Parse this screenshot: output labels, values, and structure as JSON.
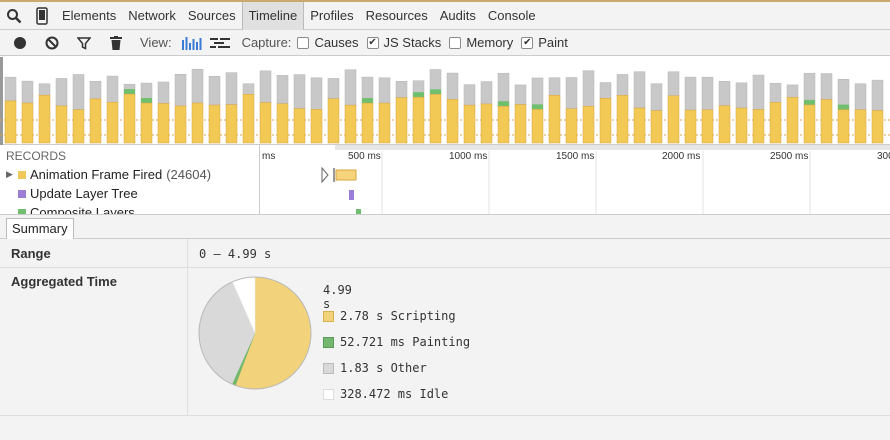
{
  "tabs": [
    {
      "label": "Elements"
    },
    {
      "label": "Network"
    },
    {
      "label": "Sources"
    },
    {
      "label": "Timeline",
      "active": true
    },
    {
      "label": "Profiles"
    },
    {
      "label": "Resources"
    },
    {
      "label": "Audits"
    },
    {
      "label": "Console"
    }
  ],
  "toolbar": {
    "view_label": "View:",
    "capture_label": "Capture:",
    "checkboxes": [
      {
        "label": "Causes",
        "checked": false
      },
      {
        "label": "JS Stacks",
        "checked": true
      },
      {
        "label": "Memory",
        "checked": false
      },
      {
        "label": "Paint",
        "checked": true
      }
    ]
  },
  "records": {
    "header": "RECORDS",
    "items": [
      {
        "label": "Animation Frame Fired",
        "count": "(24604)",
        "color": "#f0c95c",
        "expandable": true
      },
      {
        "label": "Update Layer Tree",
        "count": "",
        "color": "#9b7fd6",
        "expandable": false
      },
      {
        "label": "Composite Layers",
        "count": "",
        "color": "#6fbf6f",
        "expandable": false
      }
    ]
  },
  "ruler": {
    "ticks": [
      "ms",
      "500 ms",
      "1000 ms",
      "1500 ms",
      "2000 ms",
      "2500 ms",
      "300"
    ]
  },
  "summary": {
    "tab_label": "Summary",
    "range_label": "Range",
    "range_value": "0 – 4.99 s",
    "aggregated_label": "Aggregated Time",
    "total": "4.99 s",
    "legend": [
      {
        "label": "2.78 s Scripting",
        "color": "#f2d27a",
        "value_s": 2.78
      },
      {
        "label": "52.721 ms Painting",
        "color": "#73b76f",
        "value_s": 0.052721
      },
      {
        "label": "1.83 s Other",
        "color": "#d9d9d9",
        "value_s": 1.83
      },
      {
        "label": "328.472 ms Idle",
        "color": "#ffffff",
        "value_s": 0.328472
      }
    ]
  }
}
